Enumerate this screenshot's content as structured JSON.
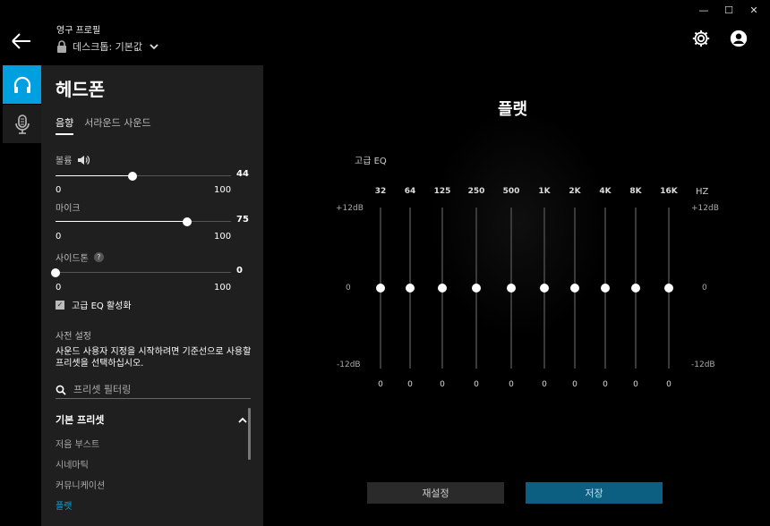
{
  "window": {
    "minimize": "—",
    "maximize": "☐",
    "close": "✕"
  },
  "header": {
    "profile_title": "영구 프로필",
    "profile_value": "데스크톱: 기본값"
  },
  "panel": {
    "title": "헤드폰",
    "tabs": [
      "음향",
      "서라운드 사운드"
    ],
    "volume": {
      "label": "볼륨",
      "value": 44,
      "min": "0",
      "max": "100"
    },
    "mic": {
      "label": "마이크",
      "value": 75,
      "min": "0",
      "max": "100"
    },
    "sidetone": {
      "label": "사이드톤",
      "value": 0,
      "min": "0",
      "max": "100",
      "help": "?"
    },
    "advanced_eq": {
      "label": "고급 EQ 활성화",
      "checked": true
    },
    "preset_section": "사전 설정",
    "preset_desc": "사운드 사용자 지정을 시작하려면 기준선으로 사용할 프리셋을 선택하십시오.",
    "filter_placeholder": "프리셋 필터링",
    "group_title": "기본 프리셋",
    "presets": [
      "저음 부스트",
      "시네마틱",
      "커뮤니케이션",
      "플랫"
    ],
    "selected_preset": "플랫"
  },
  "eq": {
    "title": "플랫",
    "label": "고급 EQ",
    "unit": "HZ",
    "db_top": "+12dB",
    "db_mid": "0",
    "db_bottom": "-12dB",
    "bands": [
      {
        "freq": "32",
        "value": 0
      },
      {
        "freq": "64",
        "value": 0
      },
      {
        "freq": "125",
        "value": 0
      },
      {
        "freq": "250",
        "value": 0
      },
      {
        "freq": "500",
        "value": 0
      },
      {
        "freq": "1K",
        "value": 0
      },
      {
        "freq": "2K",
        "value": 0
      },
      {
        "freq": "4K",
        "value": 0
      },
      {
        "freq": "8K",
        "value": 0
      },
      {
        "freq": "16K",
        "value": 0
      }
    ]
  },
  "buttons": {
    "reset": "재설정",
    "save": "저장"
  },
  "colors": {
    "accent": "#00a0e0",
    "panel": "#1f1f1f",
    "save": "#0c5f80"
  }
}
